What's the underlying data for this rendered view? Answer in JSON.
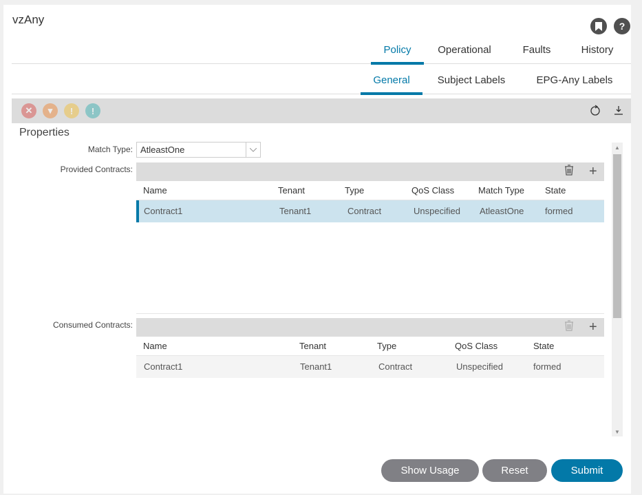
{
  "header": {
    "title": "vzAny",
    "icons": [
      "bookmark-icon",
      "help-icon"
    ]
  },
  "tabs": [
    {
      "label": "Policy",
      "active": true
    },
    {
      "label": "Operational",
      "active": false
    },
    {
      "label": "Faults",
      "active": false
    },
    {
      "label": "History",
      "active": false
    }
  ],
  "subtabs": [
    {
      "label": "General",
      "active": true
    },
    {
      "label": "Subject Labels",
      "active": false
    },
    {
      "label": "EPG-Any Labels",
      "active": false
    }
  ],
  "toolbar": {
    "fault_icons": [
      "critical-fault-icon",
      "major-fault-icon",
      "minor-fault-icon",
      "warning-fault-icon"
    ],
    "right_icons": [
      "refresh-icon",
      "download-icon"
    ]
  },
  "properties": {
    "title": "Properties",
    "match_type_label": "Match Type:",
    "match_type_value": "AtleastOne",
    "provided_label": "Provided Contracts:",
    "consumed_label": "Consumed Contracts:"
  },
  "provided": {
    "columns": [
      "Name",
      "Tenant",
      "Type",
      "QoS Class",
      "Match Type",
      "State"
    ],
    "rows": [
      [
        "Contract1",
        "Tenant1",
        "Contract",
        "Unspecified",
        "AtleastOne",
        "formed"
      ]
    ]
  },
  "consumed": {
    "columns": [
      "Name",
      "Tenant",
      "Type",
      "QoS Class",
      "State"
    ],
    "rows": [
      [
        "Contract1",
        "Tenant1",
        "Contract",
        "Unspecified",
        "formed"
      ]
    ]
  },
  "buttons": {
    "show_usage": "Show Usage",
    "reset": "Reset",
    "submit": "Submit"
  },
  "colors": {
    "accent": "#0379a8",
    "selected_row": "#cce3ee",
    "button_grey": "#808085"
  }
}
